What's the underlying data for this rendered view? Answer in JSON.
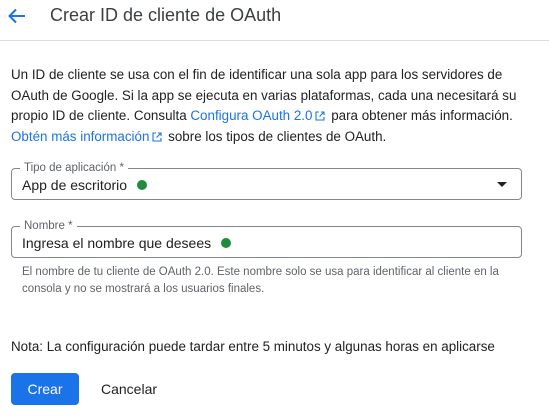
{
  "header": {
    "title": "Crear ID de cliente de OAuth"
  },
  "intro": {
    "part1": "Un ID de cliente se usa con el fin de identificar una sola app para los servidores de OAuth de Google. Si la app se ejecuta en varias plataformas, cada una necesitará su propio ID de cliente. Consulta ",
    "link1": "Configura OAuth 2.0",
    "part2": " para obtener más información. ",
    "link2": "Obtén más información",
    "part3": " sobre los tipos de clientes de OAuth."
  },
  "app_type": {
    "label": "Tipo de aplicación *",
    "value": "App de escritorio"
  },
  "name": {
    "label": "Nombre *",
    "value": "Ingresa el nombre que desees",
    "hint": "El nombre de tu cliente de OAuth 2.0. Este nombre solo se usa para identificar al cliente en la consola y no se mostrará a los usuarios finales."
  },
  "note": "Nota: La configuración puede tardar entre 5 minutos y algunas horas en aplicarse",
  "actions": {
    "create": "Crear",
    "cancel": "Cancelar"
  },
  "colors": {
    "primary": "#1a73e8",
    "status_dot": "#1e8e3e"
  },
  "icons": {
    "back": "arrow-left-icon",
    "external": "open-in-new-icon",
    "dropdown": "caret-down-icon"
  }
}
